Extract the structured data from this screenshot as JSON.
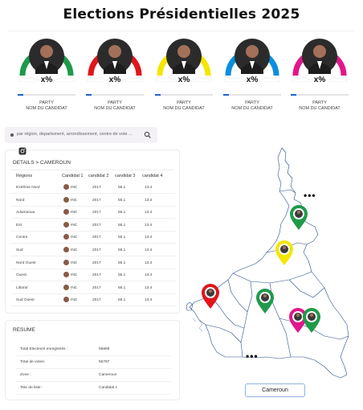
{
  "header": {
    "title": "Elections Présidentielles 2025"
  },
  "candidates": [
    {
      "color": "#1f9a4a",
      "percent": "x%",
      "party": "PARTY",
      "name": "NOM DU CANDIDAT",
      "progress": 0.1
    },
    {
      "color": "#e0161b",
      "percent": "x%",
      "party": "PARTY",
      "name": "NOM DU CANDIDAT",
      "progress": 0.1
    },
    {
      "color": "#f4e600",
      "percent": "x%",
      "party": "PARTY",
      "name": "NOM DU CANDIDAT",
      "progress": 0.1
    },
    {
      "color": "#0a8ee0",
      "percent": "x%",
      "party": "PARTY",
      "name": "NOM DU CANDIDAT",
      "progress": 0.1
    },
    {
      "color": "#e2168a",
      "percent": "x%",
      "party": "PARTY",
      "name": "NOM DU CANDIDAT",
      "progress": 0.1
    }
  ],
  "search": {
    "placeholder": "par région, departement, arrondissement, centre de vote ..."
  },
  "details": {
    "title": "DETAILS > CAMEROUN",
    "columns": [
      "Régions",
      "Candidat 1",
      "candidat 2",
      "candidat 3",
      "candidat 4"
    ],
    "rows": [
      {
        "region": "Extrême Nord",
        "c1": "INC",
        "c2": "2017",
        "c3": "56.1",
        "c4": "13.4"
      },
      {
        "region": "Nord",
        "c1": "INC",
        "c2": "2017",
        "c3": "56.1",
        "c4": "13.4"
      },
      {
        "region": "Adamaoua",
        "c1": "INC",
        "c2": "2017",
        "c3": "56.1",
        "c4": "13.4"
      },
      {
        "region": "Est",
        "c1": "INC",
        "c2": "2017",
        "c3": "56.1",
        "c4": "13.4"
      },
      {
        "region": "Centre",
        "c1": "INC",
        "c2": "2017",
        "c3": "56.1",
        "c4": "13.4"
      },
      {
        "region": "Sud",
        "c1": "INC",
        "c2": "2017",
        "c3": "56.1",
        "c4": "13.4"
      },
      {
        "region": "Nord Ouest",
        "c1": "INC",
        "c2": "2017",
        "c3": "56.1",
        "c4": "13.4"
      },
      {
        "region": "Ouest",
        "c1": "INC",
        "c2": "2017",
        "c3": "56.1",
        "c4": "13.4"
      },
      {
        "region": "Littoral",
        "c1": "INC",
        "c2": "2017",
        "c3": "56.1",
        "c4": "13.4"
      },
      {
        "region": "Sud Ouest",
        "c1": "INC",
        "c2": "2017",
        "c3": "56.1",
        "c4": "13.4"
      }
    ]
  },
  "resume": {
    "title": "RESUME",
    "items": [
      {
        "label": "Total Electeurs enregistrés :",
        "value": "56868"
      },
      {
        "label": "Total de votes:",
        "value": "56787"
      },
      {
        "label": "Zone :",
        "value": "Cameroun"
      },
      {
        "label": "Tete de liste :",
        "value": "Candidat x"
      }
    ]
  },
  "map": {
    "more_label": "•••",
    "pins": [
      {
        "color": "#1f9a4a",
        "label": "green-pin"
      },
      {
        "color": "#f4e600",
        "label": "yellow-pin"
      },
      {
        "color": "#e0161b",
        "label": "red-pin"
      },
      {
        "color": "#1f9a4a",
        "label": "green-pin"
      },
      {
        "color": "#e2168a",
        "label": "pink-pin"
      },
      {
        "color": "#1f9a4a",
        "label": "green-pin"
      }
    ]
  },
  "footer": {
    "country_button": "Cameroun"
  },
  "icons": {
    "search": "search-icon",
    "instagram": "instagram-icon",
    "menu_dot": "bullet-icon"
  }
}
